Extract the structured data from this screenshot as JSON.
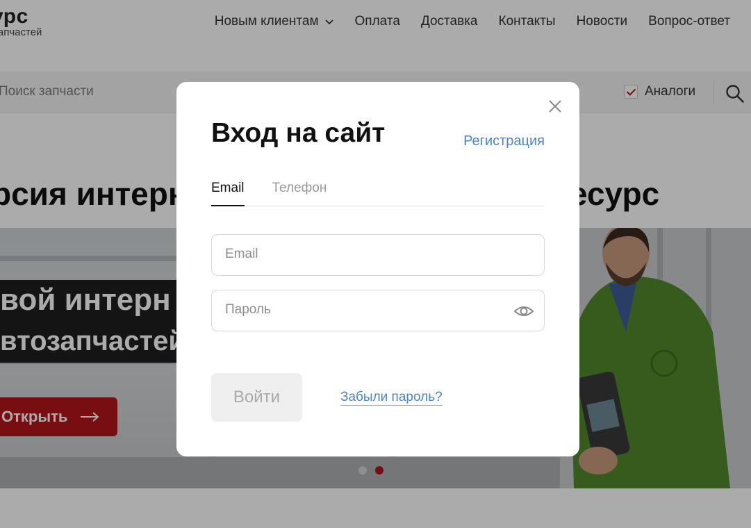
{
  "header": {
    "logo_main": "урс",
    "logo_sub": "запчастей",
    "nav": [
      {
        "label": "Новым клиентам"
      },
      {
        "label": "Оплата"
      },
      {
        "label": "Доставка"
      },
      {
        "label": "Контакты"
      },
      {
        "label": "Новости"
      },
      {
        "label": "Вопрос-ответ"
      }
    ]
  },
  "search": {
    "placeholder": "Поиск запчасти",
    "analog_label": "Аналоги",
    "analog_checked": true
  },
  "promo": {
    "title_left": "рсия интерн",
    "title_right": "есурс",
    "banner_line1": "вой интерн",
    "banner_line2": "втозапчастей",
    "button_label": "Открыть",
    "slides_total": 2,
    "active_slide": 2
  },
  "modal": {
    "title": "Вход на сайт",
    "register_label": "Регистрация",
    "tabs": [
      {
        "label": "Email"
      },
      {
        "label": "Телефон"
      }
    ],
    "email_placeholder": "Email",
    "password_placeholder": "Пароль",
    "login_label": "Войти",
    "forgot_label": "Забыли пароль?"
  },
  "colors": {
    "brand_red": "#b3141b",
    "link_blue": "#4a86c5",
    "overlay": "rgba(0,0,0,0.33)"
  },
  "icons": {
    "close": "close-icon",
    "eye": "eye-icon",
    "search": "search-icon",
    "chevron": "chevron-down-icon",
    "arrow": "arrow-right-icon"
  }
}
